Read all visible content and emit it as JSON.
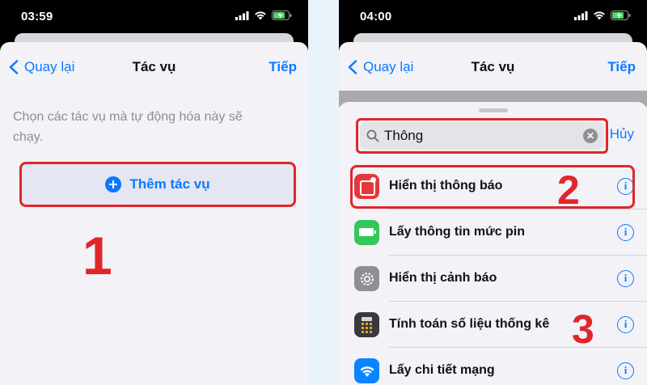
{
  "left": {
    "status_time": "03:59",
    "nav": {
      "back": "Quay lại",
      "title": "Tác vụ",
      "next": "Tiếp"
    },
    "instruction": "Chọn các tác vụ mà tự động hóa này sẽ chạy.",
    "add_action": "Thêm tác vụ",
    "step": "1"
  },
  "right": {
    "status_time": "04:00",
    "nav": {
      "back": "Quay lại",
      "title": "Tác vụ",
      "next": "Tiếp"
    },
    "search": {
      "value": "Thông",
      "cancel": "Hủy"
    },
    "step_search": "2",
    "step_result": "3",
    "actions": [
      {
        "label": "Hiển thị thông báo",
        "icon": "notification-icon",
        "color": "#e5383b"
      },
      {
        "label": "Lấy thông tin mức pin",
        "icon": "battery-icon",
        "color": "#34c759"
      },
      {
        "label": "Hiển thị cảnh báo",
        "icon": "gear-icon",
        "color": "#8e8e93"
      },
      {
        "label": "Tính toán số liệu thống kê",
        "icon": "calculator-icon",
        "color": "#3a3a3c"
      },
      {
        "label": "Lấy chi tiết mạng",
        "icon": "wifi-icon",
        "color": "#0a84ff"
      }
    ]
  },
  "colors": {
    "accent": "#0a7aff",
    "highlight": "#e0262a"
  }
}
